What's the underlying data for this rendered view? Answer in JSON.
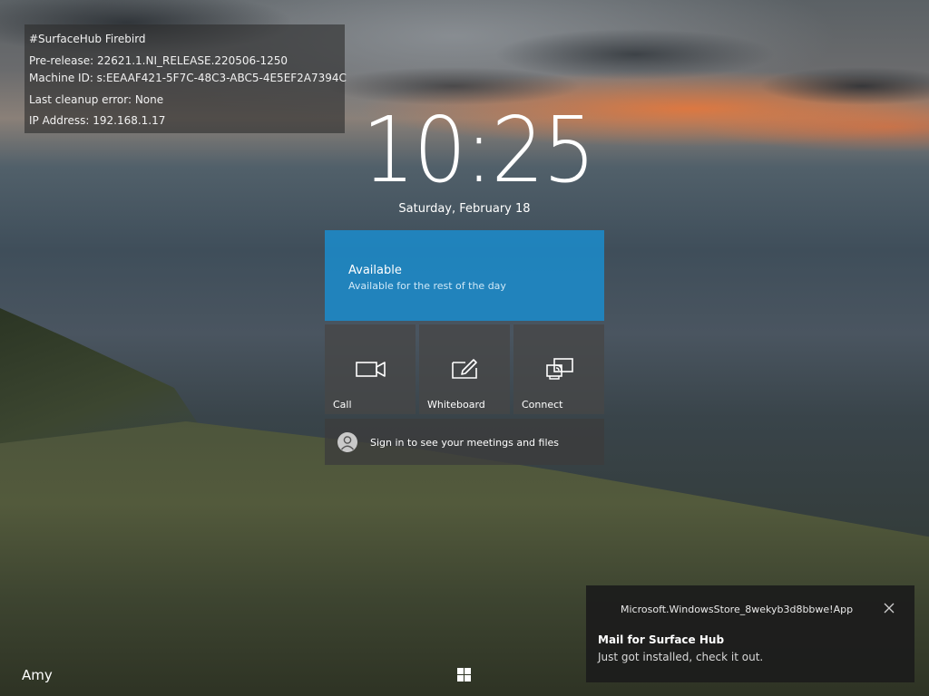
{
  "info_panel": {
    "line1": "#SurfaceHub Firebird",
    "line2": "Pre-release: 22621.1.NI_RELEASE.220506-1250",
    "line3": "Machine ID: s:EEAAF421-5F7C-48C3-ABC5-4E5EF2A7394C",
    "line4": "Last cleanup error: None",
    "line5": "IP Address: 192.168.1.17"
  },
  "clock": {
    "time": "10:25",
    "date": "Saturday, February 18"
  },
  "status": {
    "title": "Available",
    "subtitle": "Available for the rest of the day",
    "color": "#1b8ccd"
  },
  "actions": [
    {
      "label": "Call",
      "icon": "video-camera-icon"
    },
    {
      "label": "Whiteboard",
      "icon": "pen-on-board-icon"
    },
    {
      "label": "Connect",
      "icon": "cast-screen-icon"
    }
  ],
  "signin": {
    "label": "Sign in to see your meetings and files",
    "icon": "person-avatar-icon"
  },
  "notification": {
    "source": "Microsoft.WindowsStore_8wekyb3d8bbwe!App",
    "title": "Mail for Surface Hub",
    "body": "Just got installed, check it out.",
    "close_icon": "close-icon"
  },
  "footer": {
    "user_name": "Amy",
    "start_icon": "windows-logo-icon"
  }
}
